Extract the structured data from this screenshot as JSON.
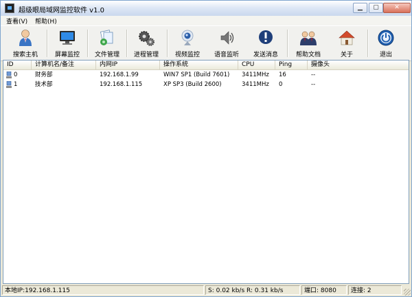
{
  "window": {
    "title": "超级眼局域网监控软件 v1.0"
  },
  "menu": [
    {
      "label": "查看(V)"
    },
    {
      "label": "帮助(H)"
    }
  ],
  "toolbar": [
    {
      "label": "搜索主机",
      "icon": "user-search-icon"
    },
    {
      "label": "屏幕监控",
      "icon": "monitor-icon"
    },
    {
      "label": "文件管理",
      "icon": "file-manager-icon"
    },
    {
      "label": "进程管理",
      "icon": "gears-icon"
    },
    {
      "label": "视频监控",
      "icon": "webcam-icon"
    },
    {
      "label": "语音监听",
      "icon": "speaker-icon"
    },
    {
      "label": "发送消息",
      "icon": "message-icon"
    },
    {
      "label": "帮助文档",
      "icon": "help-people-icon"
    },
    {
      "label": "关于",
      "icon": "house-icon"
    },
    {
      "label": "退出",
      "icon": "power-icon"
    }
  ],
  "table": {
    "columns": [
      "ID",
      "计算机名/备注",
      "内网IP",
      "操作系统",
      "CPU",
      "Ping",
      "摄像头"
    ],
    "rows": [
      [
        "0",
        "财务部",
        "192.168.1.99",
        "WIN7 SP1 (Build 7601)",
        "3411MHz",
        "16",
        "--"
      ],
      [
        "1",
        "技术部",
        "192.168.1.115",
        "XP SP3 (Build 2600)",
        "3411MHz",
        "0",
        "--"
      ]
    ]
  },
  "status": {
    "local_ip": "本地IP:192.168.1.115",
    "traffic": "S: 0.02 kb/s R: 0.31 kb/s",
    "port": "端口: 8080",
    "connections": "连接: 2"
  },
  "colors": {
    "titlebar": "#dfe8f6",
    "close_button": "#d9705a",
    "list_border": "#7f9db9"
  }
}
